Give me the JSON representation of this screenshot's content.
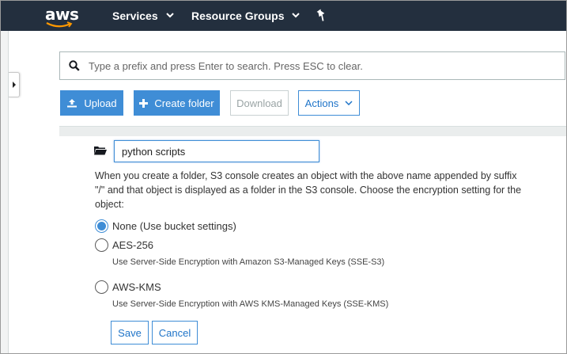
{
  "topnav": {
    "logo_text": "aws",
    "services_label": "Services",
    "resource_groups_label": "Resource Groups",
    "bg_color": "#232f3e",
    "logo_smile_color": "#ff9900"
  },
  "search": {
    "placeholder": "Type a prefix and press Enter to search. Press ESC to clear.",
    "value": ""
  },
  "toolbar": {
    "upload_label": "Upload",
    "create_folder_label": "Create folder",
    "download_label": "Download",
    "actions_label": "Actions"
  },
  "create_folder": {
    "folder_name_value": "python scripts",
    "description": "When you create a folder, S3 console creates an object with the above name appended by suffix \"/\" and that object is displayed as a folder in the S3 console. Choose the encryption setting for the object:",
    "options": [
      {
        "label": "None (Use bucket settings)",
        "help": "",
        "selected": true
      },
      {
        "label": "AES-256",
        "help": "Use Server-Side Encryption with Amazon S3-Managed Keys (SSE-S3)",
        "selected": false
      },
      {
        "label": "AWS-KMS",
        "help": "Use Server-Side Encryption with AWS KMS-Managed Keys (SSE-KMS)",
        "selected": false
      }
    ],
    "save_label": "Save",
    "cancel_label": "Cancel"
  },
  "colors": {
    "primary": "#3f8dd6",
    "link": "#1f74c8"
  }
}
